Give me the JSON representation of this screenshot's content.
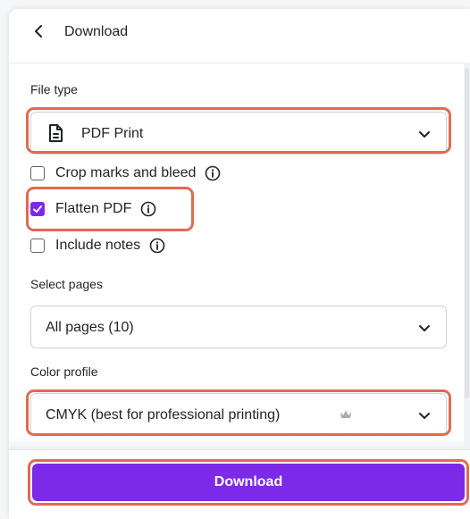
{
  "header": {
    "title": "Download"
  },
  "file_type": {
    "label": "File type",
    "value": "PDF Print",
    "options": [
      {
        "label": "Crop marks and bleed",
        "checked": false
      },
      {
        "label": "Flatten PDF",
        "checked": true
      },
      {
        "label": "Include notes",
        "checked": false
      }
    ]
  },
  "pages": {
    "label": "Select pages",
    "value": "All pages (10)"
  },
  "color_profile": {
    "label": "Color profile",
    "value": "CMYK (best for professional printing)",
    "badge_icon": "crown-icon"
  },
  "actions": {
    "download_label": "Download"
  },
  "colors": {
    "accent": "#7d2ae8",
    "highlight": "#e26a4f"
  }
}
